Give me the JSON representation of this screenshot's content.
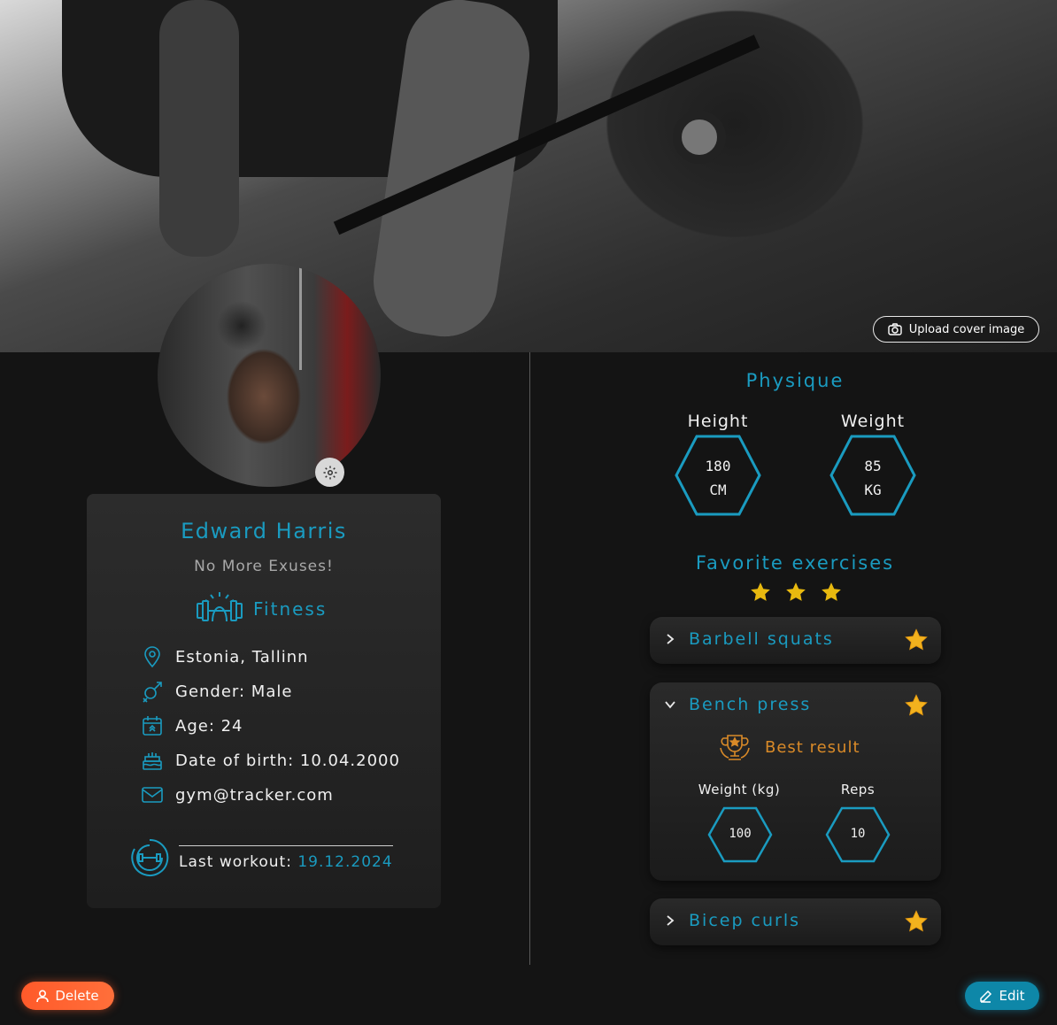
{
  "cover": {
    "upload_label": "Upload cover image"
  },
  "profile": {
    "name": "Edward Harris",
    "motto": "No More Exuses!",
    "sport": "Fitness",
    "location": "Estonia, Tallinn",
    "gender": "Gender: Male",
    "age": "Age: 24",
    "dob": "Date of birth: 10.04.2000",
    "email": "gym@tracker.com",
    "last_workout_label": "Last workout: ",
    "last_workout_date": "19.12.2024"
  },
  "physique": {
    "title": "Physique",
    "height_label": "Height",
    "height_value": "180",
    "height_unit": "CM",
    "weight_label": "Weight",
    "weight_value": "85",
    "weight_unit": "KG"
  },
  "favorites": {
    "title": "Favorite exercises",
    "stars": 3,
    "exercises": [
      {
        "name": "Barbell squats",
        "expanded": false
      },
      {
        "name": "Bench press",
        "expanded": true,
        "best_label": "Best result",
        "weight_label": "Weight (kg)",
        "weight_value": "100",
        "reps_label": "Reps",
        "reps_value": "10"
      },
      {
        "name": "Bicep curls",
        "expanded": false
      }
    ]
  },
  "actions": {
    "delete_label": "Delete",
    "edit_label": "Edit"
  },
  "colors": {
    "accent": "#1a9bc0",
    "star": "#e8b90f",
    "best": "#d98a28",
    "delete": "#ff5a2a",
    "edit": "#0e87a8"
  }
}
